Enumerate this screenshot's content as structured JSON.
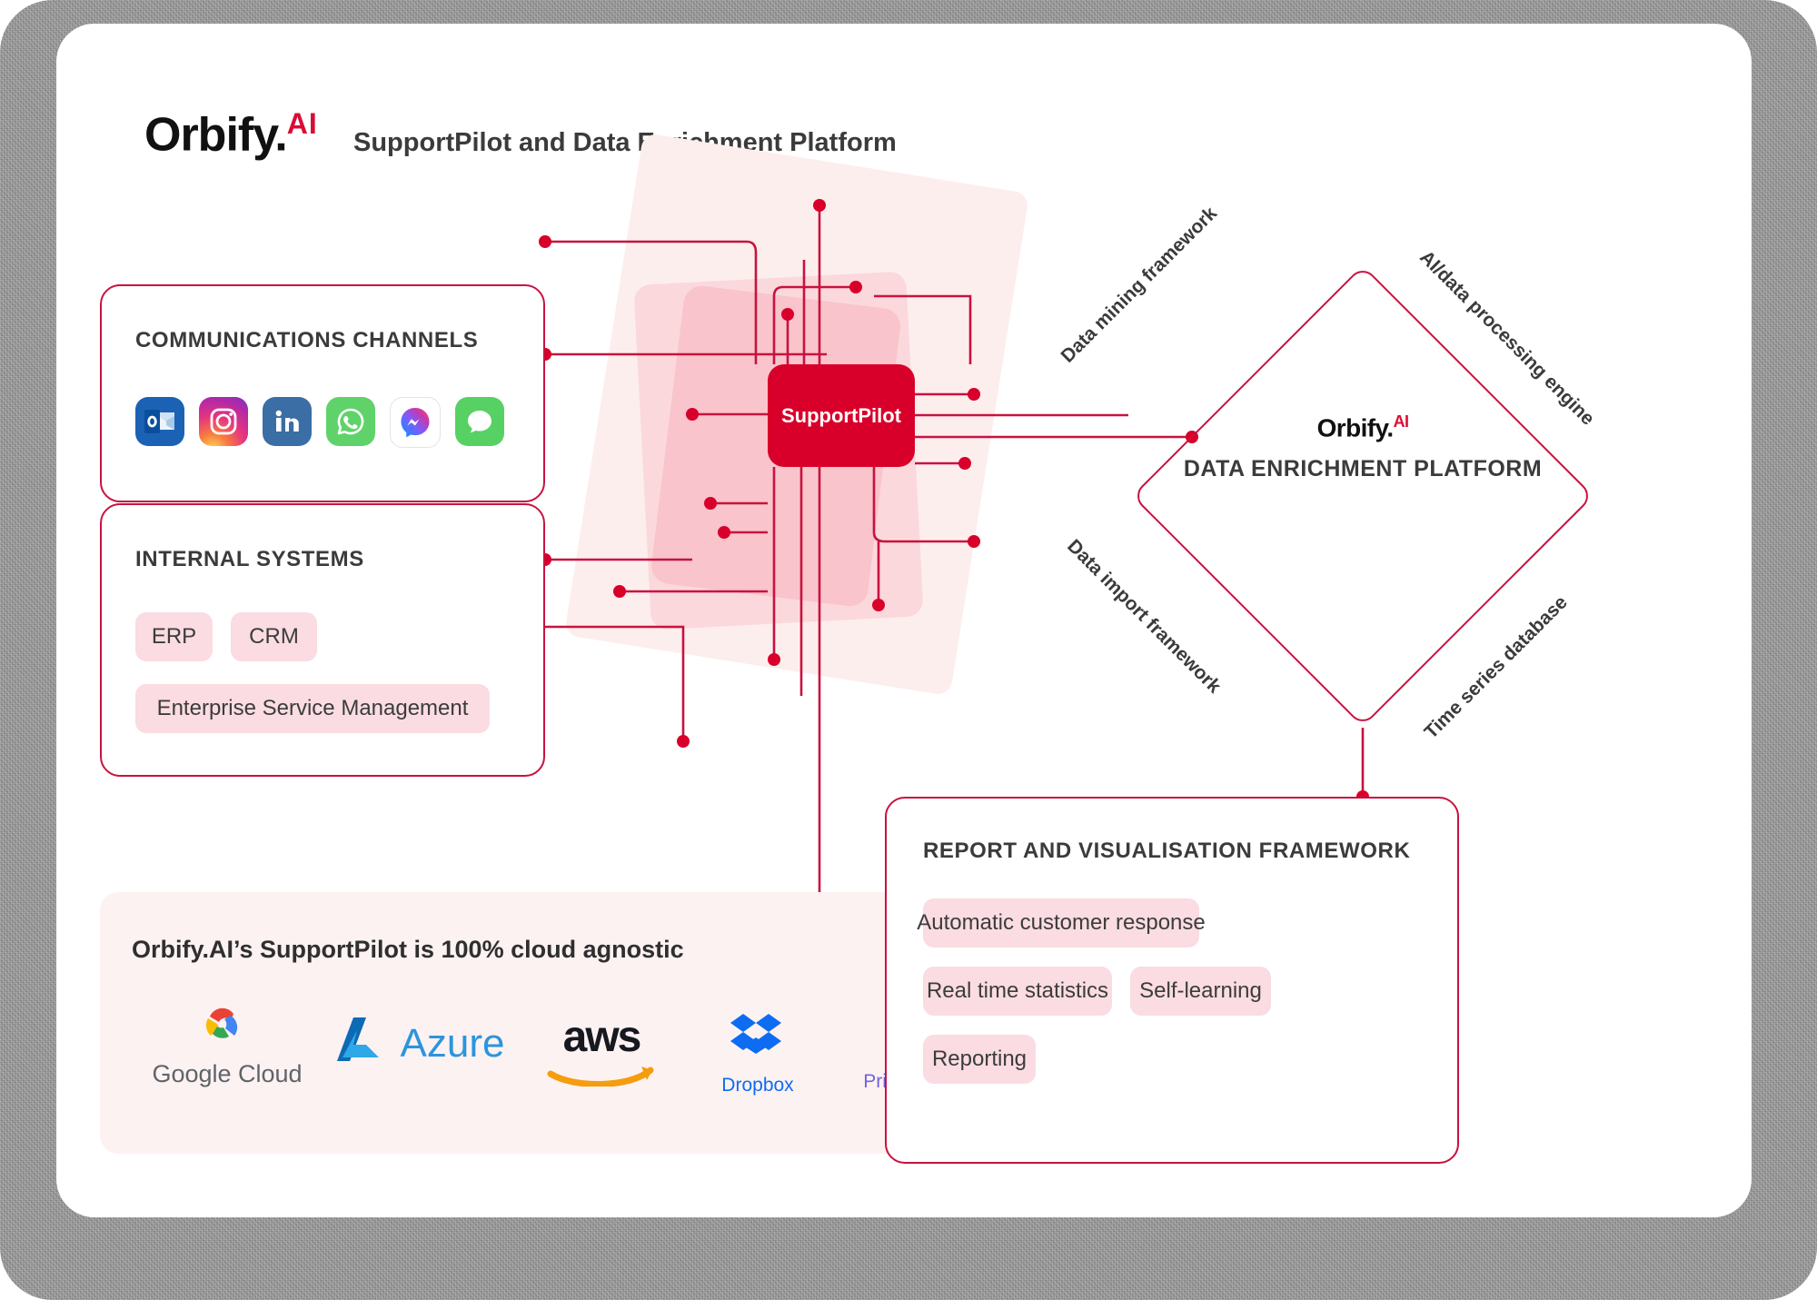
{
  "header": {
    "logo_main": "Orbify.",
    "logo_suffix": "AI",
    "title": "SupportPilot and Data Enrichment Platform"
  },
  "colors": {
    "brand_red": "#d80d36",
    "core_red": "#d8002a",
    "border_red": "#c8123f",
    "tag_pink": "#fadce2",
    "panel_pink": "#fdf2f2",
    "text_dark": "#3b3b3b"
  },
  "communications": {
    "title": "COMMUNICATIONS CHANNELS",
    "icons": [
      {
        "name": "outlook-icon",
        "label": "Outlook"
      },
      {
        "name": "instagram-icon",
        "label": "Instagram"
      },
      {
        "name": "linkedin-icon",
        "label": "LinkedIn"
      },
      {
        "name": "whatsapp-icon",
        "label": "WhatsApp"
      },
      {
        "name": "messenger-icon",
        "label": "Messenger"
      },
      {
        "name": "imessage-icon",
        "label": "iMessage"
      }
    ]
  },
  "internal_systems": {
    "title": "INTERNAL SYSTEMS",
    "tags": [
      "ERP",
      "CRM",
      "Enterprise Service Management"
    ]
  },
  "core": {
    "label": "SupportPilot"
  },
  "diamond": {
    "logo_main": "Orbify.",
    "logo_suffix": "AI",
    "title": "DATA ENRICHMENT PLATFORM",
    "edge_labels": {
      "top_left": "Data mining framework",
      "top_right": "AI/data processing engine",
      "bottom_left": "Data import framework",
      "bottom_right": "Time series database"
    }
  },
  "report": {
    "title": "REPORT AND VISUALISATION FRAMEWORK",
    "tags": [
      "Automatic customer response",
      "Real time statistics",
      "Self-learning",
      "Reporting"
    ]
  },
  "cloud": {
    "title": "Orbify.AI’s SupportPilot is 100% cloud agnostic",
    "providers": [
      {
        "name": "google-cloud-logo",
        "label": "Google Cloud"
      },
      {
        "name": "azure-logo",
        "label": "Azure"
      },
      {
        "name": "aws-logo",
        "label": "aws"
      },
      {
        "name": "dropbox-logo",
        "label": "Dropbox"
      },
      {
        "name": "private-cloud-logo",
        "label": "Private cloud"
      }
    ]
  }
}
